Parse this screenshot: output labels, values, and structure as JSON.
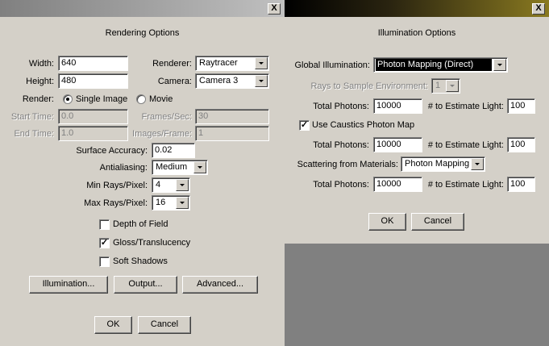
{
  "rendering": {
    "heading": "Rendering Options",
    "close": "X",
    "width_label": "Width:",
    "width_value": "640",
    "height_label": "Height:",
    "height_value": "480",
    "renderer_label": "Renderer:",
    "renderer_value": "Raytracer",
    "camera_label": "Camera:",
    "camera_value": "Camera 3",
    "render_label": "Render:",
    "single_image": "Single Image",
    "movie": "Movie",
    "start_time_label": "Start Time:",
    "start_time_value": "0.0",
    "end_time_label": "End Time:",
    "end_time_value": "1.0",
    "frames_sec_label": "Frames/Sec:",
    "frames_sec_value": "30",
    "images_frame_label": "Images/Frame:",
    "images_frame_value": "1",
    "surface_accuracy_label": "Surface Accuracy:",
    "surface_accuracy_value": "0.02",
    "antialiasing_label": "Antialiasing:",
    "antialiasing_value": "Medium",
    "min_rays_label": "Min Rays/Pixel:",
    "min_rays_value": "4",
    "max_rays_label": "Max Rays/Pixel:",
    "max_rays_value": "16",
    "depth_of_field": "Depth of Field",
    "gloss": "Gloss/Translucency",
    "soft_shadows": "Soft Shadows",
    "illumination_btn": "Illumination...",
    "output_btn": "Output...",
    "advanced_btn": "Advanced...",
    "ok": "OK",
    "cancel": "Cancel"
  },
  "illumination": {
    "heading": "Illumination Options",
    "close": "X",
    "global_label": "Global Illumination:",
    "global_value": "Photon Mapping (Direct)",
    "rays_env_label": "Rays to Sample Environment:",
    "rays_env_value": "1",
    "total_photons_label": "Total Photons:",
    "estimate_label": "# to Estimate Light:",
    "p1_total": "10000",
    "p1_est": "100",
    "caustics": "Use Caustics Photon Map",
    "p2_total": "10000",
    "p2_est": "100",
    "scattering_label": "Scattering from Materials:",
    "scattering_value": "Photon Mapping",
    "p3_total": "10000",
    "p3_est": "100",
    "ok": "OK",
    "cancel": "Cancel"
  },
  "colors": {
    "dialog_bg": "#d4d0c8",
    "left_title_gradient_start": "#808080",
    "left_title_gradient_end": "#c0c0c0",
    "right_title_gradient_start": "#000000",
    "right_title_gradient_end": "#8a7a20",
    "desktop": "#808080"
  }
}
